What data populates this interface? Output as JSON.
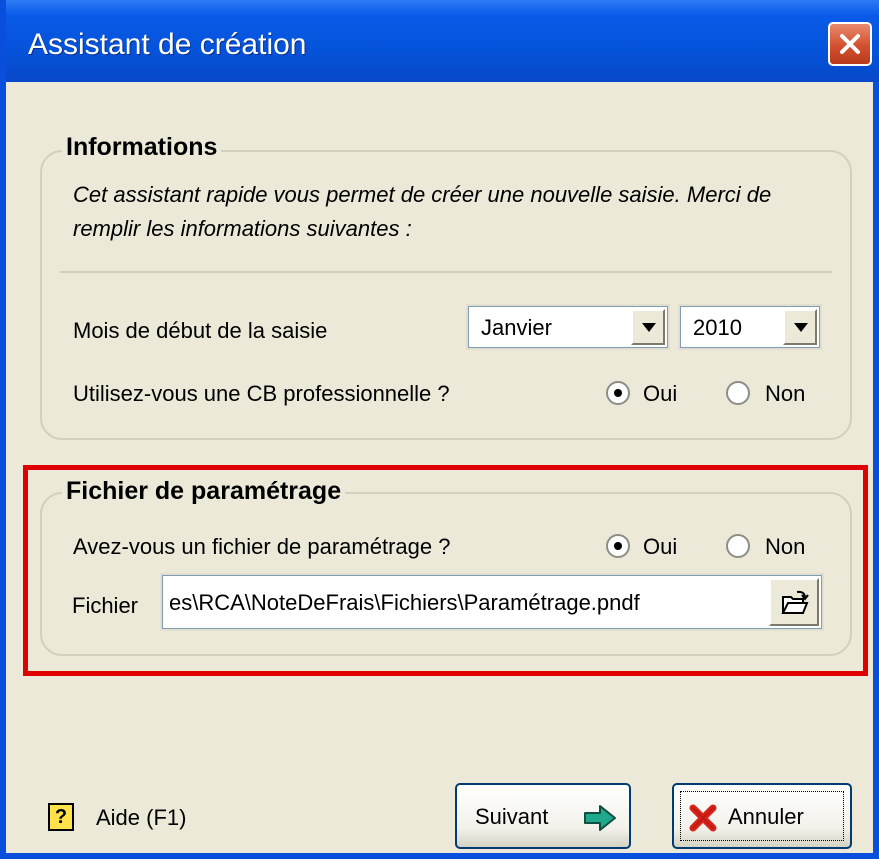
{
  "window": {
    "title": "Assistant de création"
  },
  "info_group": {
    "legend": "Informations",
    "description": "Cet assistant rapide vous permet de créer une nouvelle saisie. Merci de remplir les informations suivantes :",
    "month_label": "Mois de début de la saisie",
    "month_value": "Janvier",
    "year_value": "2010",
    "cb_question": "Utilisez-vous une CB professionnelle ?",
    "cb_yes": "Oui",
    "cb_no": "Non",
    "cb_selected": "Oui"
  },
  "param_group": {
    "legend": "Fichier de paramétrage",
    "question": "Avez-vous un fichier de paramétrage ?",
    "yes": "Oui",
    "no": "Non",
    "selected": "Oui",
    "file_label": "Fichier",
    "file_value": "es\\RCA\\NoteDeFrais\\Fichiers\\Paramétrage.pndf"
  },
  "footer": {
    "help_icon": "?",
    "help_label": "Aide (F1)",
    "next_label": "Suivant",
    "cancel_label": "Annuler"
  },
  "colors": {
    "highlight": "#E00000",
    "title_bar": "#0553DB"
  }
}
